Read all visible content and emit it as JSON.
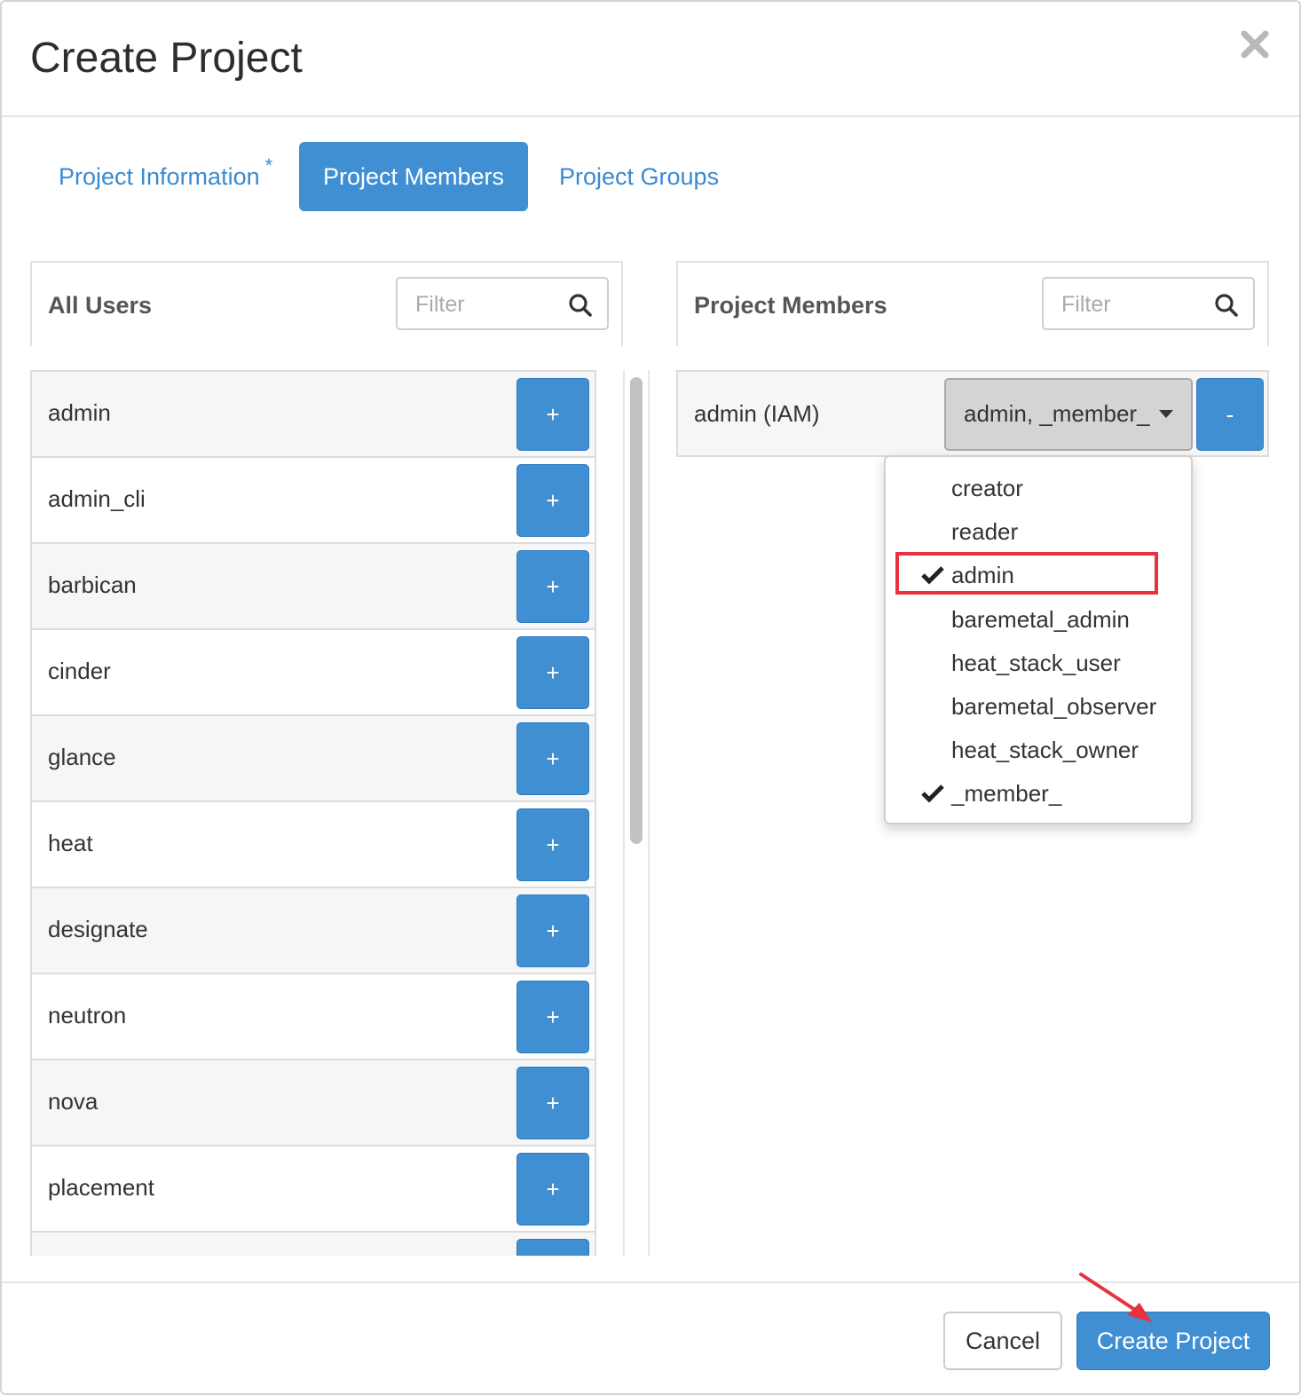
{
  "modal": {
    "title": "Create Project",
    "close_icon": "close-icon"
  },
  "tabs": [
    {
      "label": "Project Information",
      "required_marker": "*",
      "active": false
    },
    {
      "label": "Project Members",
      "active": true
    },
    {
      "label": "Project Groups",
      "active": false
    }
  ],
  "all_users": {
    "title": "All Users",
    "filter_placeholder": "Filter",
    "add_label": "+",
    "users": [
      "admin",
      "admin_cli",
      "barbican",
      "cinder",
      "glance",
      "heat",
      "designate",
      "neutron",
      "nova",
      "placement",
      ""
    ]
  },
  "project_members": {
    "title": "Project Members",
    "filter_placeholder": "Filter",
    "members": [
      {
        "name": "admin (IAM)",
        "roles_label": "admin, _member_",
        "remove_label": "-"
      }
    ]
  },
  "roles_dropdown": {
    "items": [
      {
        "label": "creator",
        "checked": false
      },
      {
        "label": "reader",
        "checked": false
      },
      {
        "label": "admin",
        "checked": true,
        "highlighted": true
      },
      {
        "label": "baremetal_admin",
        "checked": false
      },
      {
        "label": "heat_stack_user",
        "checked": false
      },
      {
        "label": "baremetal_observer",
        "checked": false
      },
      {
        "label": "heat_stack_owner",
        "checked": false
      },
      {
        "label": "_member_",
        "checked": true
      }
    ]
  },
  "footer": {
    "cancel_label": "Cancel",
    "create_label": "Create Project"
  },
  "colors": {
    "primary": "#3f8fd2",
    "annotation_red": "#e8323f"
  }
}
